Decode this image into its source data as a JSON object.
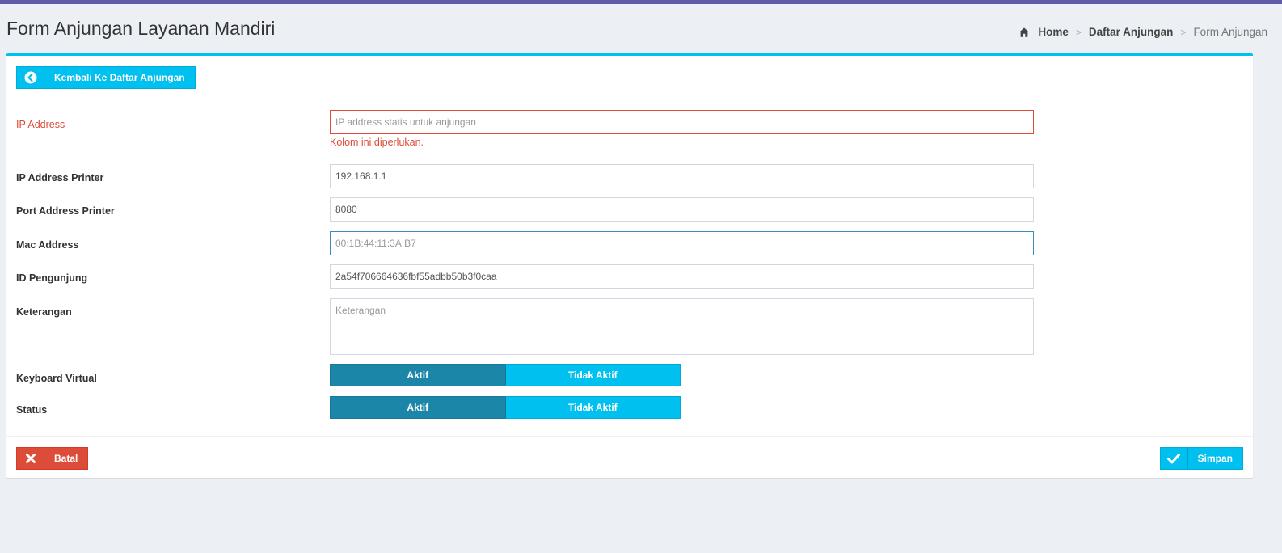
{
  "header": {
    "title": "Form Anjungan Layanan Mandiri",
    "breadcrumb": [
      "Home",
      "Daftar Anjungan",
      "Form Anjungan"
    ]
  },
  "toolbar": {
    "back_label": "Kembali Ke Daftar Anjungan"
  },
  "form": {
    "ip_address": {
      "label": "IP Address",
      "value": "",
      "placeholder": "IP address statis untuk anjungan",
      "error": "Kolom ini diperlukan."
    },
    "ip_printer": {
      "label": "IP Address Printer",
      "value": "192.168.1.1"
    },
    "port_printer": {
      "label": "Port Address Printer",
      "value": "8080"
    },
    "mac_address": {
      "label": "Mac Address",
      "value": "",
      "placeholder": "00:1B:44:11:3A:B7"
    },
    "id_pengunjung": {
      "label": "ID Pengunjung",
      "value": "2a54f706664636fbf55adbb50b3f0caa"
    },
    "keterangan": {
      "label": "Keterangan",
      "value": "",
      "placeholder": "Keterangan"
    },
    "keyboard_virtual": {
      "label": "Keyboard Virtual",
      "on_label": "Aktif",
      "off_label": "Tidak Aktif",
      "selected": "Aktif"
    },
    "status": {
      "label": "Status",
      "on_label": "Aktif",
      "off_label": "Tidak Aktif",
      "selected": "Aktif"
    }
  },
  "footer": {
    "cancel_label": "Batal",
    "save_label": "Simpan"
  },
  "colors": {
    "accent": "#00c0ef",
    "danger": "#dd4b39",
    "toggle_active": "#1b86a8",
    "top_strip": "#605ca8"
  },
  "icons": {
    "home": "home-icon",
    "back": "arrow-circle-left-icon",
    "cancel": "times-icon",
    "save": "check-icon"
  }
}
